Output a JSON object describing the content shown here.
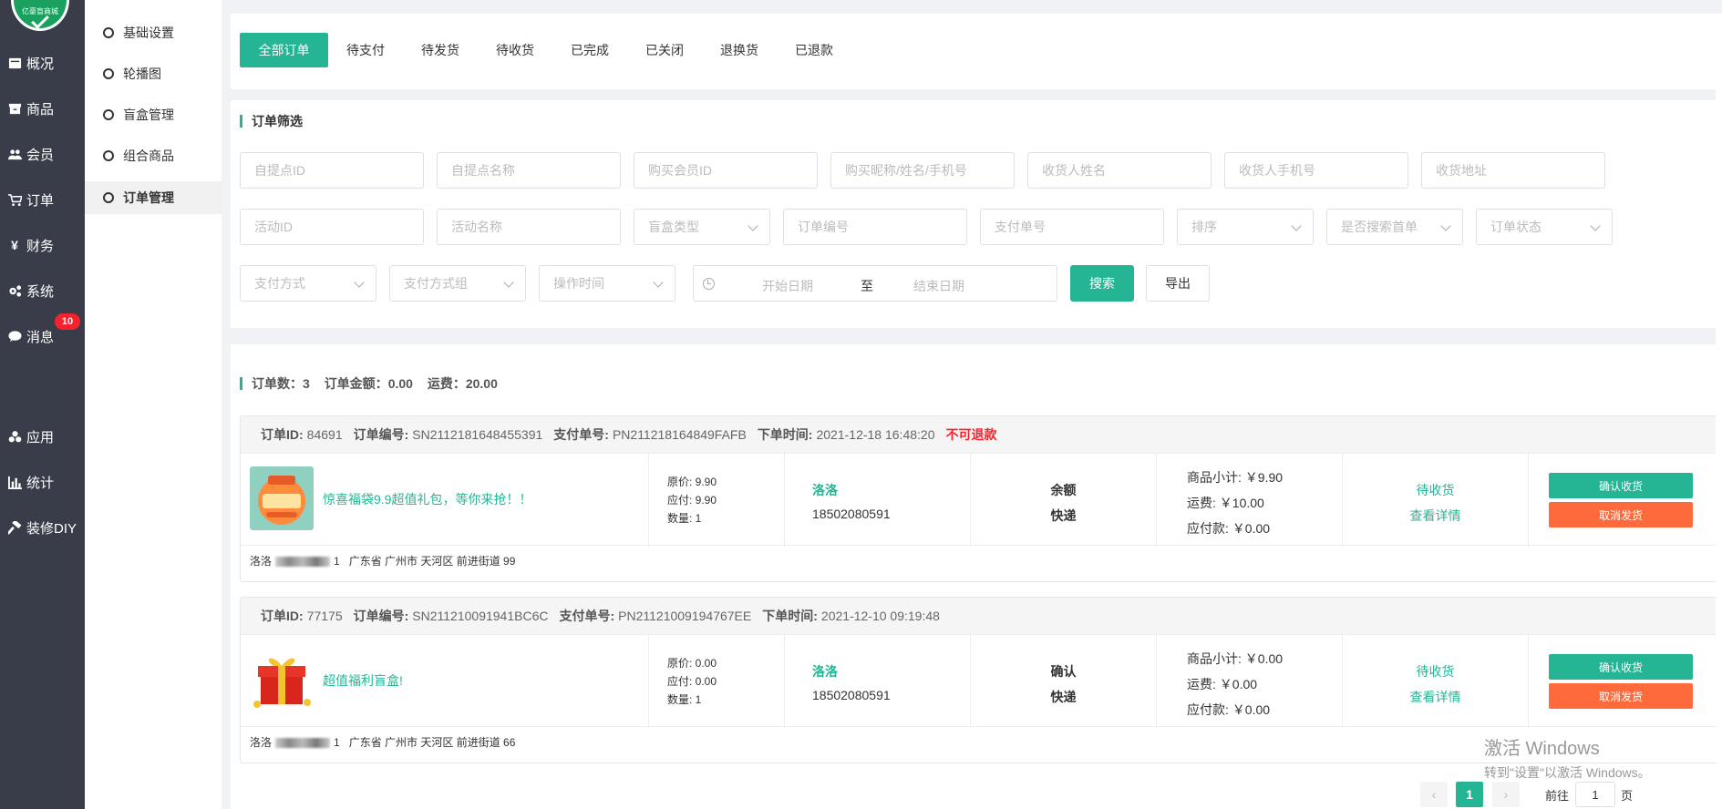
{
  "sidebar": {
    "logo_text": "亿豪盲商城",
    "items": [
      {
        "label": "概况",
        "icon": "dashboard-icon"
      },
      {
        "label": "商品",
        "icon": "box-icon"
      },
      {
        "label": "会员",
        "icon": "users-icon"
      },
      {
        "label": "订单",
        "icon": "cart-icon"
      },
      {
        "label": "财务",
        "icon": "yen-icon"
      },
      {
        "label": "系统",
        "icon": "gears-icon"
      },
      {
        "label": "消息",
        "icon": "chat-icon"
      },
      {
        "label": "应用",
        "icon": "apps-icon"
      },
      {
        "label": "统计",
        "icon": "bar-chart-icon"
      },
      {
        "label": "装修DIY",
        "icon": "hammer-icon"
      }
    ],
    "message_badge": "10"
  },
  "submenu": {
    "items": [
      "基础设置",
      "轮播图",
      "盲盒管理",
      "组合商品",
      "订单管理"
    ],
    "active": "订单管理"
  },
  "tabs": [
    "全部订单",
    "待支付",
    "待发货",
    "待收货",
    "已完成",
    "已关闭",
    "退换货",
    "已退款"
  ],
  "filter": {
    "title": "订单筛选",
    "row1": [
      "自提点ID",
      "自提点名称",
      "购买会员ID",
      "购买昵称/姓名/手机号",
      "收货人姓名",
      "收货人手机号",
      "收货地址"
    ],
    "row2_inputs": [
      "活动ID",
      "活动名称"
    ],
    "row2_selects": [
      "盲盒类型"
    ],
    "row2_inputs_b": [
      "订单编号",
      "支付单号"
    ],
    "row2_selects_b": [
      "排序",
      "是否搜索首单",
      "订单状态"
    ],
    "row3_selects": [
      "支付方式",
      "支付方式组",
      "操作时间"
    ],
    "date_start": "开始日期",
    "date_sep": "至",
    "date_end": "结束日期",
    "search_label": "搜索",
    "export_label": "导出"
  },
  "summary": {
    "count_label": "订单数：",
    "count": "3",
    "amount_label": "订单金额：",
    "amount": "0.00",
    "freight_label": "运费：",
    "freight": "20.00"
  },
  "orders": [
    {
      "id_label": "订单ID:",
      "id": "84691",
      "no_label": "订单编号:",
      "no": "SN2112181648455391",
      "pay_no_label": "支付单号:",
      "pay_no": "PN211218164849FAFB",
      "time_label": "下单时间:",
      "time": "2021-12-18 16:48:20",
      "flag": "不可退款",
      "goods_name": "惊喜福袋9.9超值礼包，等你来抢！！",
      "orig_price": "原价: 9.90",
      "pay_price": "应付: 9.90",
      "qty": "数量: 1",
      "buyer": "洛洛",
      "phone": "18502080591",
      "pay_method": "余额",
      "ship_method": "快递",
      "subtotal": "商品小计: ￥9.90",
      "freight": "运费: ￥10.00",
      "payable": "应付款: ￥0.00",
      "status": "待收货",
      "detail": "查看详情",
      "btn_confirm": "确认收货",
      "btn_cancel": "取消发货",
      "addr_name": "洛洛",
      "addr_phone_tail": "1",
      "address": "广东省 广州市 天河区 前进街道 99"
    },
    {
      "id_label": "订单ID:",
      "id": "77175",
      "no_label": "订单编号:",
      "no": "SN211210091941BC6C",
      "pay_no_label": "支付单号:",
      "pay_no": "PN21121009194767EE",
      "time_label": "下单时间:",
      "time": "2021-12-10 09:19:48",
      "flag": "",
      "goods_name": "超值福利盲盒!",
      "orig_price": "原价: 0.00",
      "pay_price": "应付: 0.00",
      "qty": "数量: 1",
      "buyer": "洛洛",
      "phone": "18502080591",
      "pay_method": "确认",
      "ship_method": "快递",
      "subtotal": "商品小计: ￥0.00",
      "freight": "运费: ￥0.00",
      "payable": "应付款: ￥0.00",
      "status": "待收货",
      "detail": "查看详情",
      "btn_confirm": "确认收货",
      "btn_cancel": "取消发货",
      "addr_name": "洛洛",
      "addr_phone_tail": "1",
      "address": "广东省 广州市 天河区 前进街道 66"
    }
  ],
  "watermark": {
    "line1": "激活 Windows",
    "line2": "转到\"设置\"以激活 Windows。"
  },
  "pager": {
    "current": "1",
    "goto_label": "前往",
    "goto_value": "1",
    "page_suffix": "页"
  },
  "colors": {
    "accent": "#26b594",
    "danger": "#f5222d",
    "cancel": "#ff6a3c",
    "sidebar": "#393d49"
  }
}
